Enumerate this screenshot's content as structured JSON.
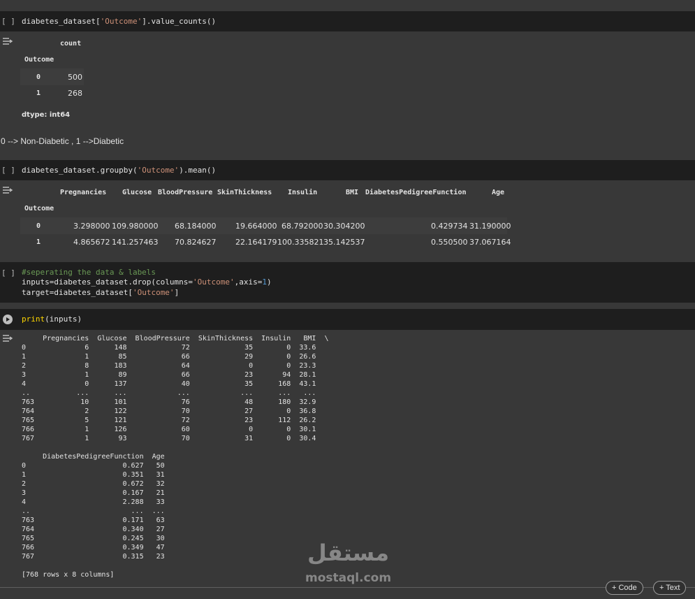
{
  "cell1": {
    "bracket": "[ ]",
    "code": "diabetes_dataset['Outcome'].value_counts()",
    "output": {
      "col_header": "count",
      "index_name": "Outcome",
      "rows": [
        {
          "idx": "0",
          "val": "500"
        },
        {
          "idx": "1",
          "val": "268"
        }
      ],
      "dtype": "dtype: int64"
    }
  },
  "markdown1": "0 --> Non-Diabetic , 1 -->Diabetic",
  "cell2": {
    "bracket": "[ ]",
    "code": "diabetes_dataset.groupby('Outcome').mean()",
    "output": {
      "columns": [
        "Pregnancies",
        "Glucose",
        "BloodPressure",
        "SkinThickness",
        "Insulin",
        "BMI",
        "DiabetesPedigreeFunction",
        "Age"
      ],
      "index_name": "Outcome",
      "rows": [
        {
          "idx": "0",
          "vals": [
            "3.298000",
            "109.980000",
            "68.184000",
            "19.664000",
            "68.792000",
            "30.304200",
            "0.429734",
            "31.190000"
          ]
        },
        {
          "idx": "1",
          "vals": [
            "4.865672",
            "141.257463",
            "70.824627",
            "22.164179",
            "100.335821",
            "35.142537",
            "0.550500",
            "37.067164"
          ]
        }
      ]
    }
  },
  "cell3": {
    "bracket": "[ ]",
    "comment": "#seperating the data & labels",
    "line2": "inputs=diabetes_dataset.drop(columns='Outcome',axis=1)",
    "line3": "target=diabetes_dataset['Outcome']"
  },
  "cell4": {
    "code": "print(inputs)",
    "output_lines": [
      "     Pregnancies  Glucose  BloodPressure  SkinThickness  Insulin   BMI  \\",
      "0              6      148             72             35        0  33.6",
      "1              1       85             66             29        0  26.6",
      "2              8      183             64              0        0  23.3",
      "3              1       89             66             23       94  28.1",
      "4              0      137             40             35      168  43.1",
      "..           ...      ...            ...            ...      ...   ...",
      "763           10      101             76             48      180  32.9",
      "764            2      122             70             27        0  36.8",
      "765            5      121             72             23      112  26.2",
      "766            1      126             60              0        0  30.1",
      "767            1       93             70             31        0  30.4",
      "",
      "     DiabetesPedigreeFunction  Age",
      "0                       0.627   50",
      "1                       0.351   31",
      "2                       0.672   32",
      "3                       0.167   21",
      "4                       2.288   33",
      "..                        ...  ...",
      "763                     0.171   63",
      "764                     0.340   27",
      "765                     0.245   30",
      "766                     0.349   47",
      "767                     0.315   23",
      "",
      "[768 rows x 8 columns]"
    ]
  },
  "toolbar": {
    "code_label": "+ Code",
    "text_label": "+ Text"
  },
  "watermark": {
    "arabic": "مستقل",
    "latin": "mostaql.com"
  }
}
